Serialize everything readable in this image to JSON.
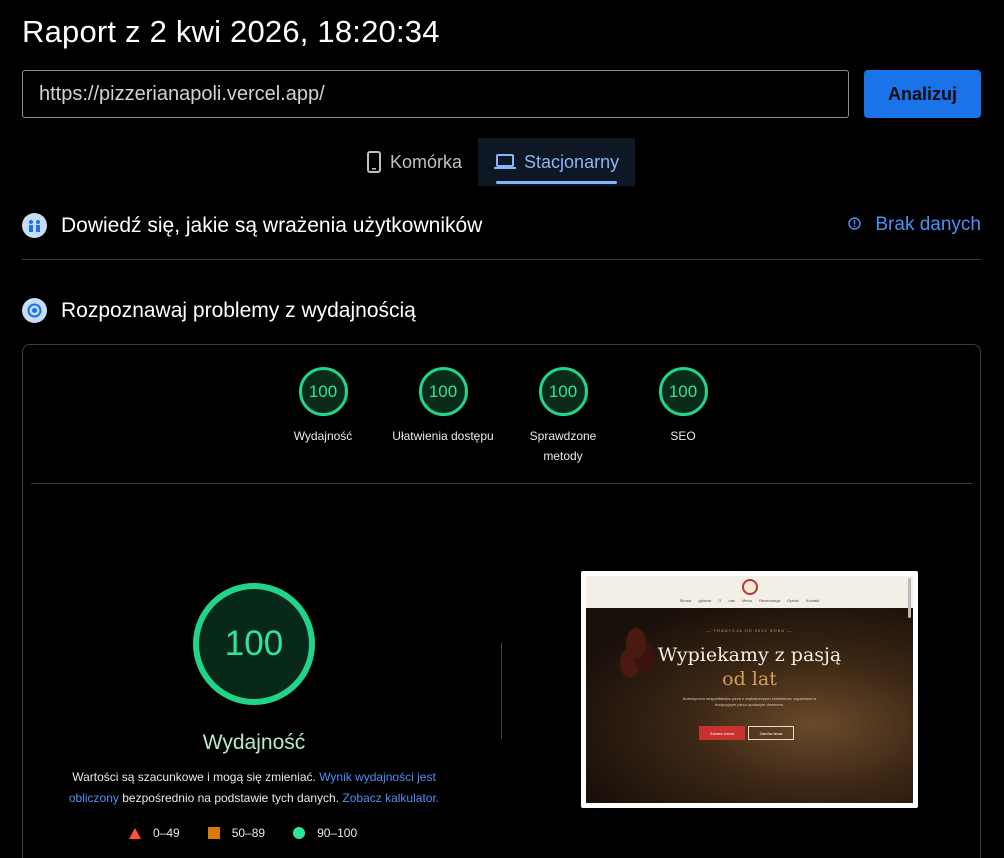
{
  "report": {
    "title": "Raport z 2 kwi 2026, 18:20:34"
  },
  "search": {
    "url": "https://pizzerianapoli.vercel.app/",
    "analyze_label": "Analizuj"
  },
  "tabs": [
    {
      "label": "Komórka",
      "icon": "phone-icon",
      "active": false
    },
    {
      "label": "Stacjonarny",
      "icon": "laptop-icon",
      "active": true
    }
  ],
  "ux_section": {
    "title": "Dowiedź się, jakie są wrażenia użytkowników",
    "status": "Brak danych"
  },
  "perf_section": {
    "title": "Rozpoznawaj problemy z wydajnością"
  },
  "scores": [
    {
      "value": "100",
      "label": "Wydajność"
    },
    {
      "value": "100",
      "label": "Ułatwienia dostępu"
    },
    {
      "value": "100",
      "label": "Sprawdzone metody"
    },
    {
      "value": "100",
      "label": "SEO"
    }
  ],
  "main_score": {
    "value": "100",
    "label": "Wydajność",
    "note_start": "Wartości są szacunkowe i mogą się zmieniać.",
    "note_link1": "Wynik wydajności jest obliczony",
    "note_middle": "bezpośrednio na podstawie tych danych.",
    "note_link2": "Zobacz kalkulator."
  },
  "legend": [
    {
      "range": "0–49",
      "shape": "triangle",
      "color": "#ff4e42"
    },
    {
      "range": "50–89",
      "shape": "square",
      "color": "#d97b0b"
    },
    {
      "range": "90–100",
      "shape": "circle",
      "color": "#2ee59a"
    }
  ],
  "thumbnail": {
    "menu": "Strona główna O nas Menu Rezerwacja Opinie Kontakt",
    "pretitle": "— TRADYCJA OD 2012 ROKU —",
    "heading_1": "Wypiekamy z pasją",
    "heading_2": "od lat",
    "paragraph": "Autentyczna neapolitańska pizza z najświeższych składników, wypiekana w tradycyjnym piecu opalanym drewnem.",
    "button_primary": "Zobacz menu",
    "button_secondary": "Zamów teraz"
  },
  "colors": {
    "accent": "#1a73e8",
    "pass": "#2ee59a",
    "link": "#4d8ff5"
  }
}
